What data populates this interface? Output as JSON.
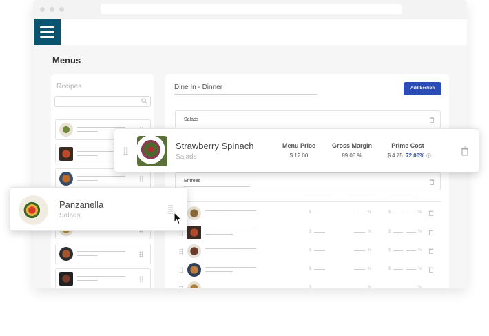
{
  "page": {
    "title": "Menus"
  },
  "recipes_panel": {
    "title": "Recipes",
    "search": {
      "placeholder": "",
      "value": ""
    },
    "item_count": 7
  },
  "menu": {
    "name": "Dine In - Dinner",
    "add_section_label": "Add Section",
    "sections": [
      {
        "label": "Salads"
      },
      {
        "label": "Entrees"
      }
    ],
    "placeholder_text": {
      "currency": "$",
      "percent": "%"
    }
  },
  "dragged_card": {
    "name": "Strawberry Spinach",
    "category": "Salads",
    "metrics": [
      {
        "label": "Menu Price",
        "value": "$ 12.00"
      },
      {
        "label": "Gross Margin",
        "value": "89.05 %"
      },
      {
        "label": "Prime Cost",
        "value": "$ 4.75",
        "highlight": "72.00%"
      }
    ]
  },
  "drag_recipe_card": {
    "name": "Panzanella",
    "category": "Salads"
  },
  "colors": {
    "brand": "#0b5470",
    "accent": "#2b4bb5"
  }
}
